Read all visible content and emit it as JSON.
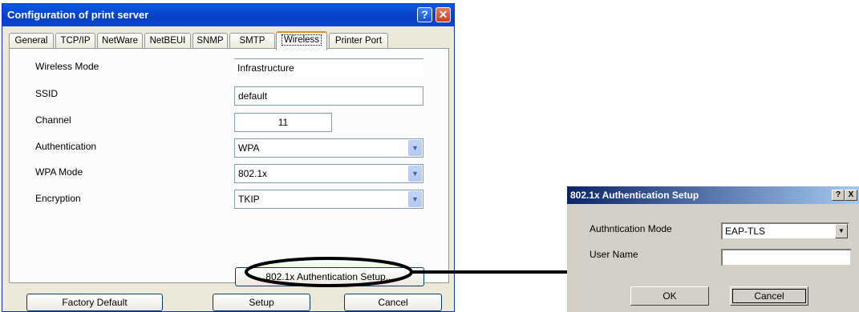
{
  "main_window": {
    "title": "Configuration of print server",
    "help_glyph": "?",
    "close_glyph": "✕",
    "tabs": [
      {
        "label": "General"
      },
      {
        "label": "TCP/IP"
      },
      {
        "label": "NetWare"
      },
      {
        "label": "NetBEUI"
      },
      {
        "label": "SNMP"
      },
      {
        "label": "SMTP"
      },
      {
        "label": "Wireless",
        "active": true
      },
      {
        "label": "Printer Port"
      }
    ],
    "fields": {
      "wireless_mode": {
        "label": "Wireless Mode",
        "value": "Infrastructure"
      },
      "ssid": {
        "label": "SSID",
        "value": "default"
      },
      "channel": {
        "label": "Channel",
        "value": "11"
      },
      "authentication": {
        "label": "Authentication",
        "value": "WPA"
      },
      "wpa_mode": {
        "label": "WPA Mode",
        "value": "802.1x"
      },
      "encryption": {
        "label": "Encryption",
        "value": "TKIP"
      }
    },
    "auth_setup_button": "802.1x Authentication Setup...",
    "buttons": {
      "factory_default": "Factory Default",
      "setup": "Setup",
      "cancel": "Cancel"
    },
    "dropdown_arrow_icon": "chevron-down-icon"
  },
  "auth_dialog": {
    "title": "802.1x Authentication Setup",
    "help_glyph": "?",
    "close_glyph": "X",
    "mode": {
      "label": "Authntication Mode",
      "value": "EAP-TLS"
    },
    "user_name": {
      "label": "User Name",
      "value": ""
    },
    "buttons": {
      "ok": "OK",
      "cancel": "Cancel"
    }
  },
  "colors": {
    "xp_title_blue": "#0a5be5",
    "highlight_ring": "#000000",
    "connector_line": "#000000"
  }
}
